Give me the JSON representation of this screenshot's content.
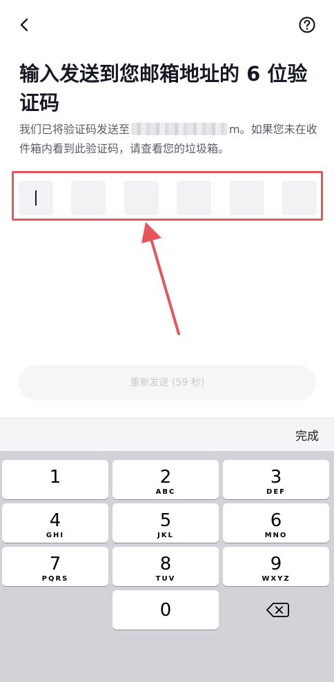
{
  "header": {
    "back_icon": "chevron-left-icon",
    "help_icon": "question-circle-icon"
  },
  "title": "输入发送到您邮箱地址的 6 位验证码",
  "description": {
    "prefix": "我们已将验证码发送至",
    "masked_email_suffix": "m",
    "suffix": "。如果您未在收件箱内看到此验证码，请查看您的垃圾箱。"
  },
  "code": {
    "length": 6,
    "entered": [
      "",
      "",
      "",
      "",
      "",
      ""
    ]
  },
  "annotation": {
    "highlight_color": "#e8545a"
  },
  "resend_button": {
    "label": "重新发送 (59 秒)"
  },
  "keyboard": {
    "done_label": "完成",
    "keys": [
      {
        "num": "1",
        "letters": ""
      },
      {
        "num": "2",
        "letters": "ABC"
      },
      {
        "num": "3",
        "letters": "DEF"
      },
      {
        "num": "4",
        "letters": "GHI"
      },
      {
        "num": "5",
        "letters": "JKL"
      },
      {
        "num": "6",
        "letters": "MNO"
      },
      {
        "num": "7",
        "letters": "PQRS"
      },
      {
        "num": "8",
        "letters": "TUV"
      },
      {
        "num": "9",
        "letters": "WXYZ"
      },
      {
        "num": "0",
        "letters": ""
      }
    ],
    "delete_icon": "backspace-icon"
  }
}
